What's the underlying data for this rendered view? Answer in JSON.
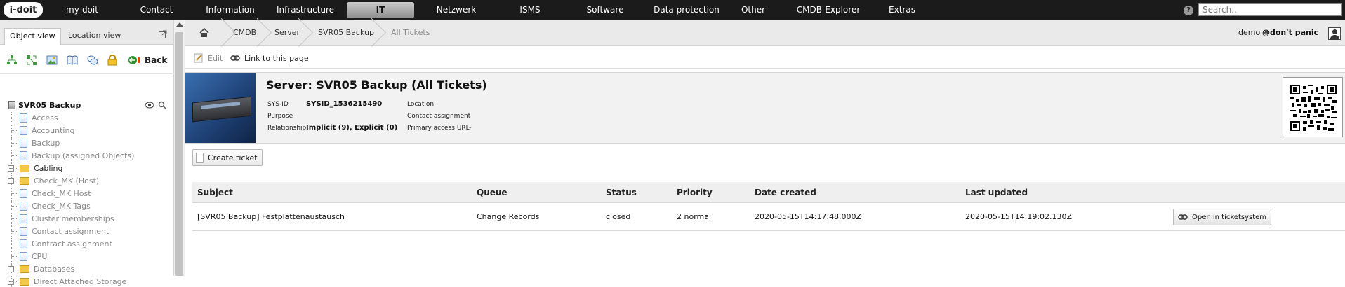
{
  "topnav": {
    "logo": "i-doit",
    "items": [
      "my-doit",
      "Contact",
      "Information",
      "Infrastructure",
      "IT",
      "Netzwerk",
      "ISMS",
      "Software",
      "Data protection",
      "Other",
      "CMDB-Explorer",
      "Extras"
    ],
    "active": "IT",
    "search_placeholder": "Search.."
  },
  "leftpane": {
    "tabs": [
      "Object view",
      "Location view"
    ],
    "back_label": "Back",
    "tree_root": "SVR05 Backup",
    "tree_items": [
      {
        "label": "Access",
        "type": "doc"
      },
      {
        "label": "Accounting",
        "type": "doc"
      },
      {
        "label": "Backup",
        "type": "doc"
      },
      {
        "label": "Backup (assigned Objects)",
        "type": "doc"
      },
      {
        "label": "Cabling",
        "type": "folder"
      },
      {
        "label": "Check_MK (Host)",
        "type": "folder"
      },
      {
        "label": "Check_MK Host",
        "type": "doc"
      },
      {
        "label": "Check_MK Tags",
        "type": "doc"
      },
      {
        "label": "Cluster memberships",
        "type": "doc"
      },
      {
        "label": "Contact assignment",
        "type": "doc"
      },
      {
        "label": "Contract assignment",
        "type": "doc"
      },
      {
        "label": "CPU",
        "type": "doc"
      },
      {
        "label": "Databases",
        "type": "folder"
      },
      {
        "label": "Direct Attached Storage",
        "type": "folder"
      }
    ]
  },
  "breadcrumb": {
    "items": [
      "CMDB",
      "Server",
      "SVR05 Backup",
      "All Tickets"
    ],
    "user": "demo",
    "tenant": "@don't panic"
  },
  "actions": {
    "edit": "Edit",
    "link": "Link to this page"
  },
  "object": {
    "title": "Server: SVR05 Backup (All Tickets)",
    "sysid_label": "SYS-ID",
    "sysid_value": "SYSID_1536215490",
    "purpose_label": "Purpose",
    "relationship_label": "Relationship",
    "relationship_value": "Implicit (9), Explicit (0)",
    "location_label": "Location",
    "contact_label": "Contact assignment",
    "access_url_label": "Primary access URL",
    "access_url_value": "-"
  },
  "create_ticket_label": "Create ticket",
  "tickets": {
    "columns": [
      "Subject",
      "Queue",
      "Status",
      "Priority",
      "Date created",
      "Last updated"
    ],
    "rows": [
      {
        "subject": "[SVR05 Backup] Festplattenaustausch",
        "queue": "Change Records",
        "status": "closed",
        "priority": "2 normal",
        "created": "2020-05-15T14:17:48.000Z",
        "updated": "2020-05-15T14:19:02.130Z",
        "action": "Open in ticketsystem"
      }
    ]
  }
}
